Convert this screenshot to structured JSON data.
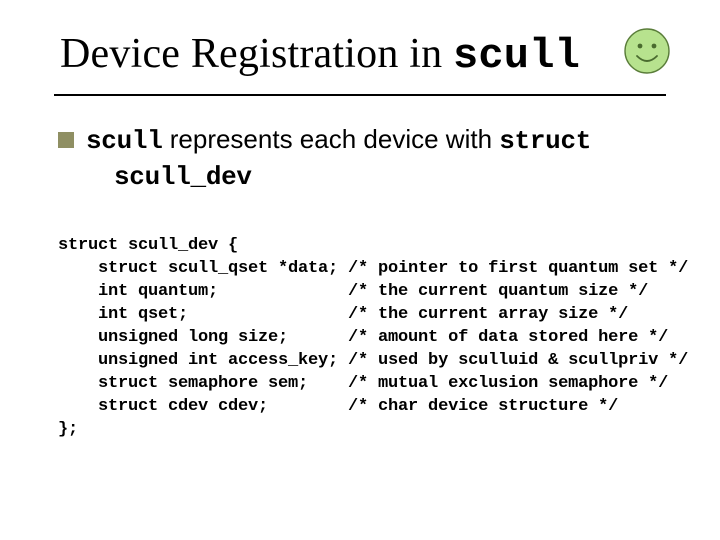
{
  "title": {
    "prefix": "Device Registration in ",
    "mono": "scull"
  },
  "bullet": {
    "lead_mono": "scull",
    "mid": " represents each device with ",
    "tail_mono": "struct",
    "line2_mono": "scull_dev"
  },
  "code": {
    "l0": "struct scull_dev {",
    "l1": "    struct scull_qset *data; /* pointer to first quantum set */",
    "l2": "    int quantum;             /* the current quantum size */",
    "l3": "    int qset;                /* the current array size */",
    "l4": "    unsigned long size;      /* amount of data stored here */",
    "l5": "    unsigned int access_key; /* used by sculluid & scullpriv */",
    "l6": "    struct semaphore sem;    /* mutual exclusion semaphore */",
    "l7": "    struct cdev cdev;        /* char device structure */",
    "l8": "};"
  },
  "colors": {
    "bullet_square": "#8f8f63",
    "smiley_fill": "#b7e28e",
    "smiley_stroke": "#5a7d3a"
  }
}
